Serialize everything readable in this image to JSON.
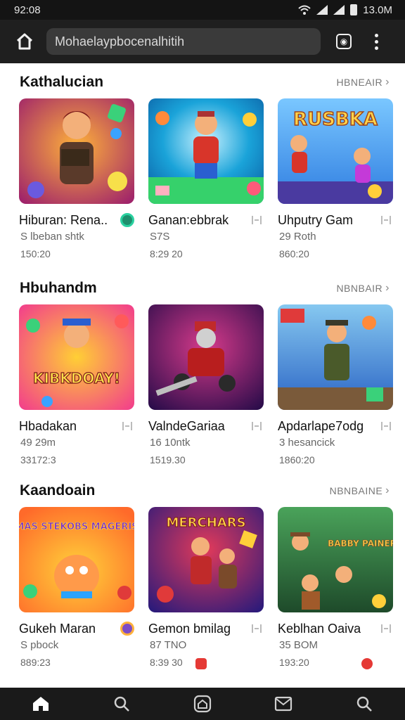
{
  "status": {
    "time": "92:08",
    "right_time": "13.0M"
  },
  "toolbar": {
    "url": "Mohaelaypbocenalhitih"
  },
  "sections": [
    {
      "title": "Kathalucian",
      "see_all": "HBNEAIR",
      "cards": [
        {
          "title": "Hiburan: Rena..",
          "sub": "S lbeban shtk",
          "meta": "150:20",
          "thumb_text": "",
          "colors": [
            "#a0246a",
            "#ffb23a"
          ]
        },
        {
          "title": "Ganan:ebbrak",
          "sub": "S7S",
          "meta": "8:29 20",
          "thumb_text": "",
          "colors": [
            "#1aa3d9",
            "#36d16b"
          ]
        },
        {
          "title": "Uhputry Gam",
          "sub": "29 Roth",
          "meta": "860:20",
          "thumb_text": "RUSBKA",
          "colors": [
            "#2f7de0",
            "#ffd34a"
          ]
        }
      ]
    },
    {
      "title": "Hbuhandm",
      "see_all": "NBNBAIR",
      "cards": [
        {
          "title": "Hbadakan",
          "sub": "49 29m",
          "meta": "33172:3",
          "thumb_text": "KIBKDOAY!",
          "colors": [
            "#f23d8c",
            "#ffcf35"
          ]
        },
        {
          "title": "ValndeGariaa",
          "sub": "16 10ntk",
          "meta": "1519.30",
          "thumb_text": "",
          "colors": [
            "#4b1c7a",
            "#d63a8a"
          ]
        },
        {
          "title": "Apdarlape7odg",
          "sub": "3 hesancick",
          "meta": "1860:20",
          "thumb_text": "",
          "colors": [
            "#2a63c4",
            "#86c8f0"
          ]
        }
      ]
    },
    {
      "title": "Kaandoain",
      "see_all": "NBNBAINE",
      "cards": [
        {
          "title": "Gukeh Maran",
          "sub": "S pbock",
          "meta": "889:23",
          "thumb_text": "MAS STEKOBS MAGERIS",
          "colors": [
            "#ff6a2a",
            "#ffd23a"
          ]
        },
        {
          "title": "Gemon bmilag",
          "sub": "87 TNO",
          "meta": "8:39 30",
          "thumb_text": "MERCHARS",
          "colors": [
            "#5b2ab0",
            "#e23a5a"
          ]
        },
        {
          "title": "Keblhan Oaiva",
          "sub": "35 BOM",
          "meta": "193:20",
          "thumb_text": "BABBY PAINER",
          "colors": [
            "#2a7a3a",
            "#ffc33a"
          ]
        }
      ]
    }
  ],
  "icons": {
    "home": "home-icon",
    "search": "search-icon",
    "center": "home-outline-icon",
    "mail": "mail-icon",
    "profile": "search-person-icon"
  }
}
